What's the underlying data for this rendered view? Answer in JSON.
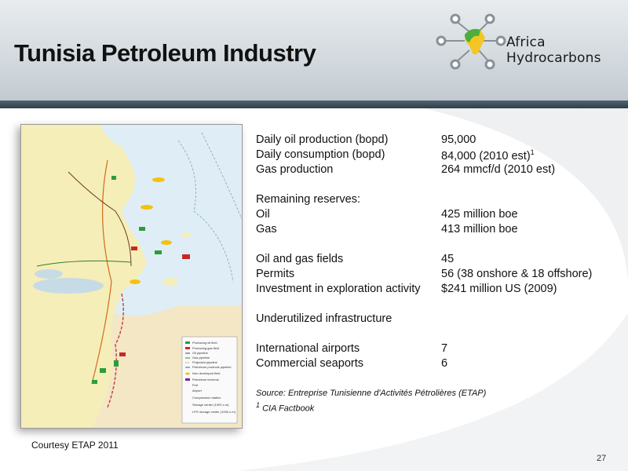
{
  "slide": {
    "title": "Tunisia Petroleum Industry",
    "page_number": "27"
  },
  "logo": {
    "text": "Africa Hydrocarbons",
    "colors": {
      "node": "#8a9096",
      "green": "#4cae3c",
      "yellow": "#f3c623"
    }
  },
  "map": {
    "caption": "Courtesy ETAP 2011",
    "legend": [
      "Producing oil field",
      "Producing gas field",
      "Oil pipeline",
      "Gas pipeline",
      "Projected pipeline",
      "Petroleum products pipeline",
      "Non developed field",
      "Petroleum terminal",
      "Port",
      "Airport",
      "Compression station",
      "Storage center (1000 c.m)",
      "LPG storage center (1000 c.m)"
    ]
  },
  "facts": {
    "rows": [
      {
        "label": "Daily oil production (bopd)",
        "value": "95,000"
      },
      {
        "label": "Daily consumption (bopd)",
        "value": "84,000 (2010 est)",
        "sup": "1"
      },
      {
        "label": "Gas production",
        "value": "264 mmcf/d (2010 est)"
      },
      {
        "label": "Remaining reserves:",
        "value": ""
      },
      {
        "label": "Oil",
        "value": "425 million boe"
      },
      {
        "label": "Gas",
        "value": "413 million boe"
      },
      {
        "label": "Oil and gas fields",
        "value": "45"
      },
      {
        "label": "Permits",
        "value": "56 (38 onshore & 18 offshore)"
      },
      {
        "label": "Investment in exploration activity",
        "value": "$241 million US (2009)"
      },
      {
        "label": "Underutilized infrastructure",
        "value": ""
      },
      {
        "label": "International airports",
        "value": "7"
      },
      {
        "label": "Commercial seaports",
        "value": "6"
      }
    ]
  },
  "source": {
    "line1": "Source:  Entreprise Tunisienne d'Activités Pétrolières (ETAP)",
    "line2_sup": "1",
    "line2": " CIA Factbook"
  }
}
